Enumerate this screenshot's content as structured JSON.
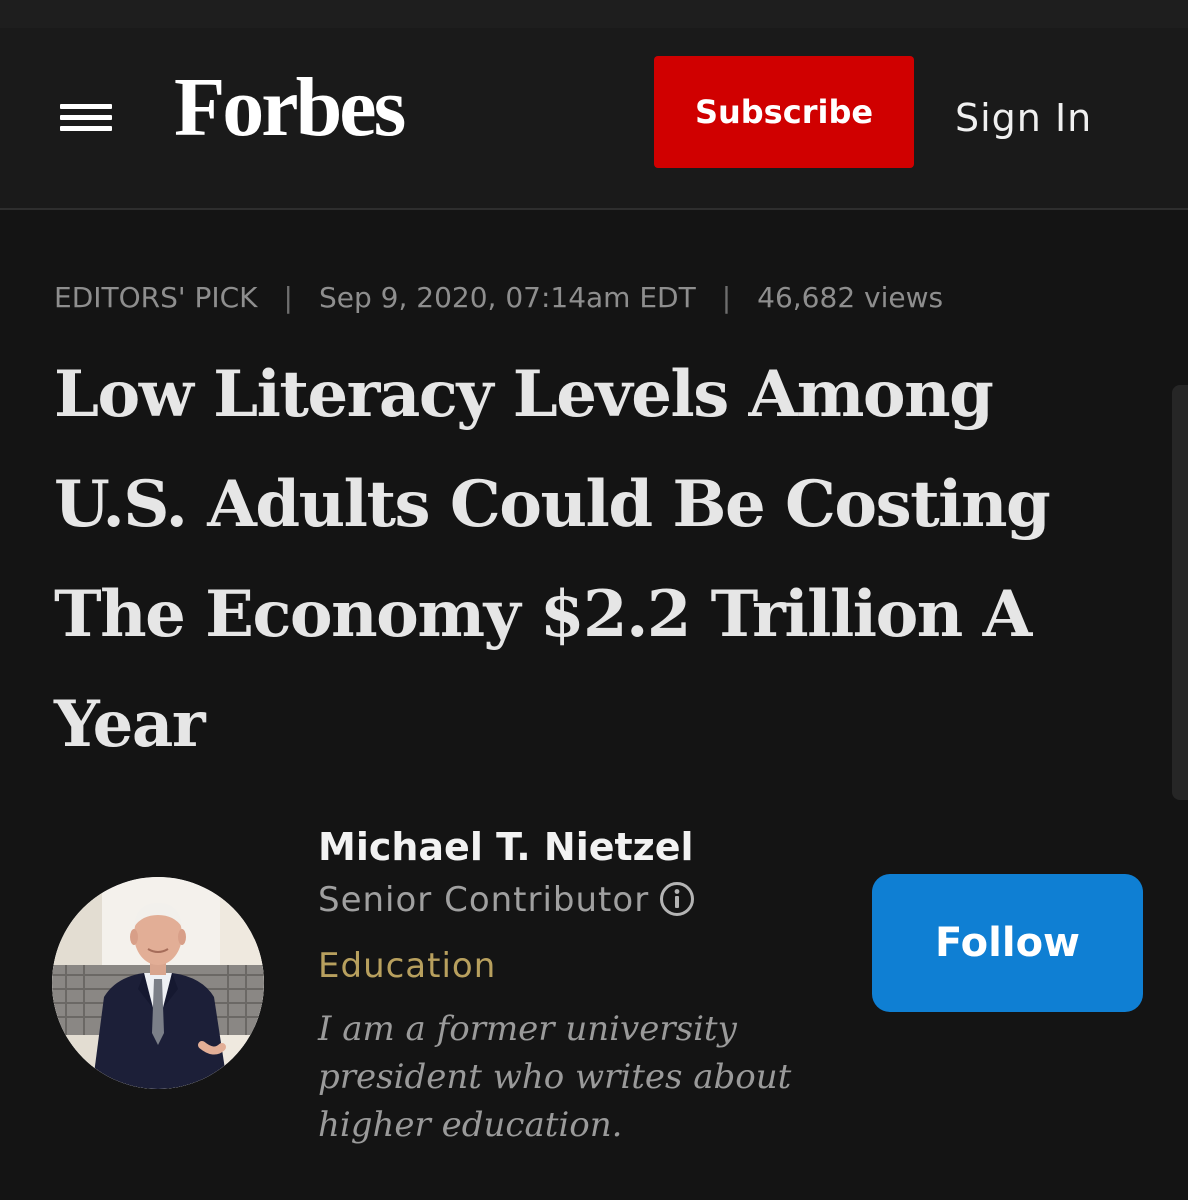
{
  "header": {
    "logo": "Forbes",
    "subscribe_label": "Subscribe",
    "signin_label": "Sign In"
  },
  "meta": {
    "label": "EDITORS' PICK",
    "separator": "|",
    "date": "Sep 9, 2020, 07:14am EDT",
    "views": "46,682 views"
  },
  "article": {
    "headline": "Low Literacy Levels Among U.S. Adults Could Be Costing The Economy $2.2 Trillion A Year"
  },
  "author": {
    "name": "Michael T. Nietzel",
    "role": "Senior Contributor",
    "topic": "Education",
    "bio": "I am a former university president who writes about higher education.",
    "follow_label": "Follow"
  },
  "colors": {
    "background": "#141414",
    "header_background": "#1a1a1a",
    "subscribe": "#d00000",
    "follow": "#0f7fd3",
    "topic": "#b8a05e"
  },
  "icons": {
    "menu": "hamburger-menu-icon",
    "info": "info-icon"
  }
}
